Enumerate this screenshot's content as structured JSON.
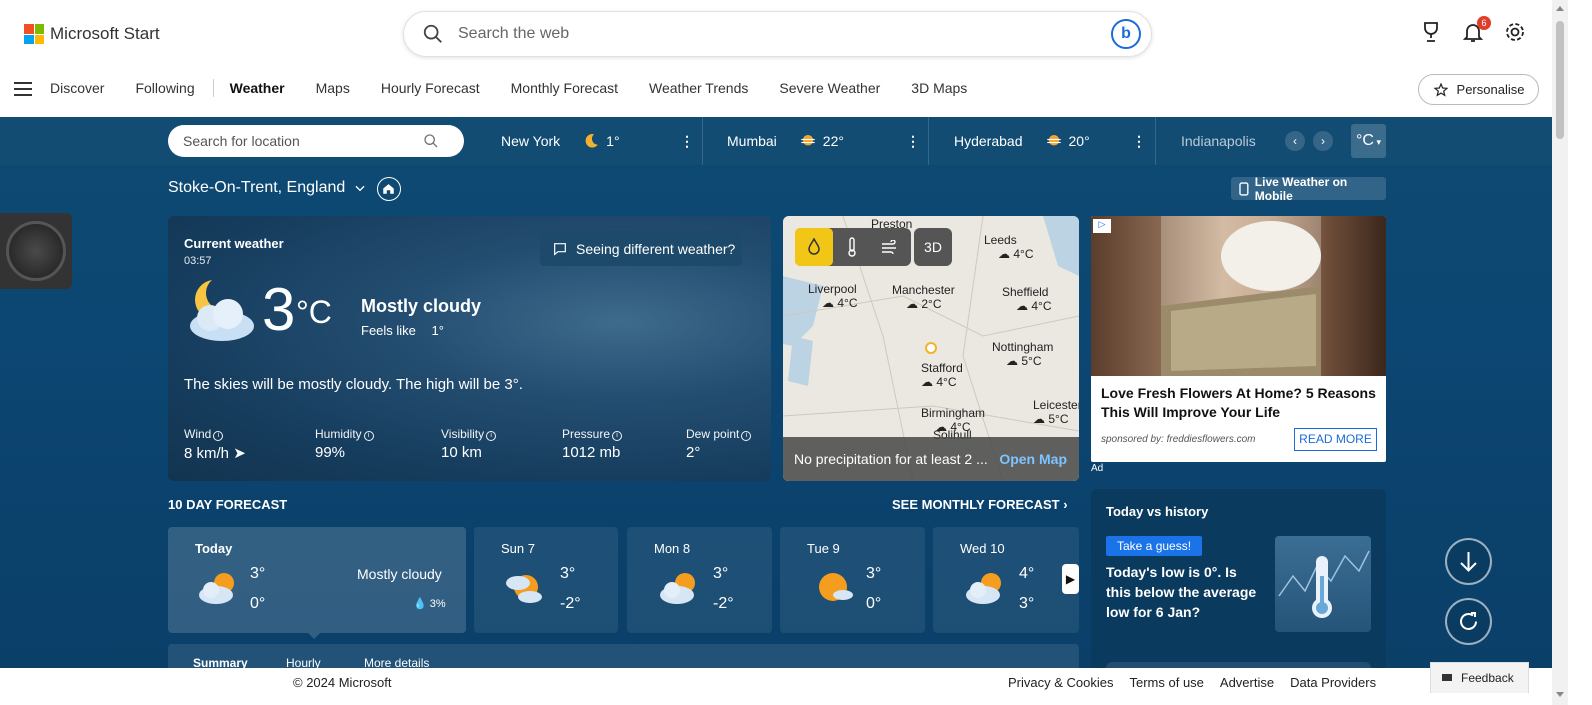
{
  "header": {
    "logo_text": "Microsoft Start",
    "search_placeholder": "Search the web",
    "notification_count": "6"
  },
  "nav": {
    "items": [
      "Discover",
      "Following",
      "Weather",
      "Maps",
      "Hourly Forecast",
      "Monthly Forecast",
      "Weather Trends",
      "Severe Weather",
      "3D Maps"
    ],
    "active": "Weather",
    "personalise_label": "Personalise"
  },
  "location_bar": {
    "search_placeholder": "Search for location",
    "cities": [
      {
        "name": "New York",
        "temp": "1°",
        "icon": "moon-icon"
      },
      {
        "name": "Mumbai",
        "temp": "22°",
        "icon": "haze-sun-icon"
      },
      {
        "name": "Hyderabad",
        "temp": "20°",
        "icon": "haze-sun-icon"
      },
      {
        "name": "Indianapolis",
        "temp": "",
        "icon": ""
      }
    ],
    "unit_label": "°C"
  },
  "location": {
    "title": "Stoke-On-Trent, England",
    "live_mobile_label": "Live Weather on Mobile"
  },
  "current": {
    "label": "Current weather",
    "time": "03:57",
    "report_label": "Seeing different weather?",
    "temp": "3",
    "unit": "°C",
    "condition": "Mostly cloudy",
    "feels_like_label": "Feels like",
    "feels_like_value": "1°",
    "description": "The skies will be mostly cloudy. The high will be 3°.",
    "metrics": [
      {
        "label": "Wind",
        "value": "8 km/h"
      },
      {
        "label": "Humidity",
        "value": "99%"
      },
      {
        "label": "Visibility",
        "value": "10 km"
      },
      {
        "label": "Pressure",
        "value": "1012 mb"
      },
      {
        "label": "Dew point",
        "value": "2°"
      }
    ]
  },
  "map": {
    "places": [
      {
        "name": "Preston",
        "temp": ""
      },
      {
        "name": "Leeds",
        "temp": "4°C"
      },
      {
        "name": "Liverpool",
        "temp": "4°C"
      },
      {
        "name": "Manchester",
        "temp": "2°C"
      },
      {
        "name": "Sheffield",
        "temp": "4°C"
      },
      {
        "name": "Nottingham",
        "temp": "5°C"
      },
      {
        "name": "Stafford",
        "temp": "4°C"
      },
      {
        "name": "Birmingham",
        "temp": "4°C"
      },
      {
        "name": "Leicester",
        "temp": "5°C"
      },
      {
        "name": "Solihull",
        "temp": ""
      }
    ],
    "mode_3d_label": "3D",
    "precip_text": "No precipitation for at least 2 ...",
    "open_map_label": "Open Map"
  },
  "ad": {
    "title": "Love Fresh Flowers At Home? 5 Reasons This Will Improve Your Life",
    "sponsor": "sponsored by: freddiesflowers.com",
    "cta": "READ MORE",
    "label": "Ad"
  },
  "forecast": {
    "title": "10 DAY FORECAST",
    "monthly_link": "SEE MONTHLY FORECAST",
    "days": [
      {
        "name": "Today",
        "hi": "3°",
        "lo": "0°",
        "condition": "Mostly cloudy",
        "precip": "3%",
        "icon": "sun-cloud-icon"
      },
      {
        "name": "Sun 7",
        "hi": "3°",
        "lo": "-2°",
        "icon": "sun-cloud-icon"
      },
      {
        "name": "Mon 8",
        "hi": "3°",
        "lo": "-2°",
        "icon": "sun-cloud-icon"
      },
      {
        "name": "Tue 9",
        "hi": "3°",
        "lo": "0°",
        "icon": "sun-small-cloud-icon"
      },
      {
        "name": "Wed 10",
        "hi": "4°",
        "lo": "3°",
        "icon": "sun-cloud-icon"
      }
    ],
    "tabs": [
      "Summary",
      "Hourly",
      "More details"
    ]
  },
  "history": {
    "title": "Today vs history",
    "badge": "Take a guess!",
    "question": "Today's low is 0°. Is this below the average low for 6 Jan?"
  },
  "footer": {
    "copyright": "© 2024 Microsoft",
    "links": [
      "Privacy & Cookies",
      "Terms of use",
      "Advertise",
      "Data Providers"
    ],
    "feedback_label": "Feedback"
  },
  "colors": {
    "accent": "#1c6bd8",
    "weather_bg": "#0e4a74",
    "map_tool_active": "#f2c617"
  }
}
